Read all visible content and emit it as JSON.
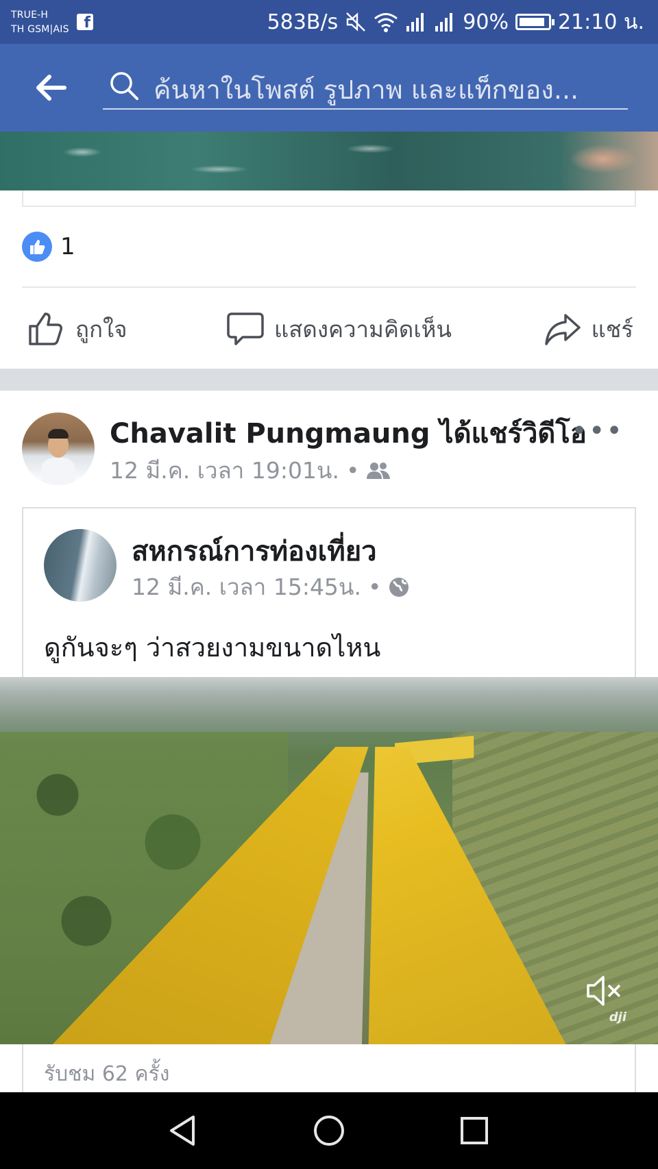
{
  "status_bar": {
    "carrier_line1": "TRUE-H",
    "carrier_line2": "TH GSM|AIS",
    "network_speed": "583B/s",
    "battery": "90%",
    "battery_level": 0.9,
    "time": "21:10 น."
  },
  "search": {
    "placeholder": "ค้นหาในโพสต์ รูปภาพ และแท็กของ..."
  },
  "previous_post": {
    "reaction_count": "1",
    "actions": {
      "like": "ถูกใจ",
      "comment": "แสดงความคิดเห็น",
      "share": "แชร์"
    }
  },
  "shared_post": {
    "poster_name": "Chavalit Pungmaung",
    "action_text": " ได้แชร์วิดีโอ",
    "timestamp": "12 มี.ค. เวลา 19:01น.",
    "audience_icon": "friends-icon",
    "original": {
      "page_name": "สหกรณ์การท่องเที่ยว",
      "timestamp": "12 มี.ค. เวลา 15:45น.",
      "audience_icon": "globe-icon",
      "text": "ดูกันจะๆ ว่าสวยงามขนาดไหน"
    },
    "video": {
      "watermark": "dji"
    },
    "views": "รับชม 62 ครั้ง"
  },
  "colors": {
    "header_blue": "#4267b2",
    "status_blue": "#34529a",
    "like_blue": "#4c8cf5"
  }
}
